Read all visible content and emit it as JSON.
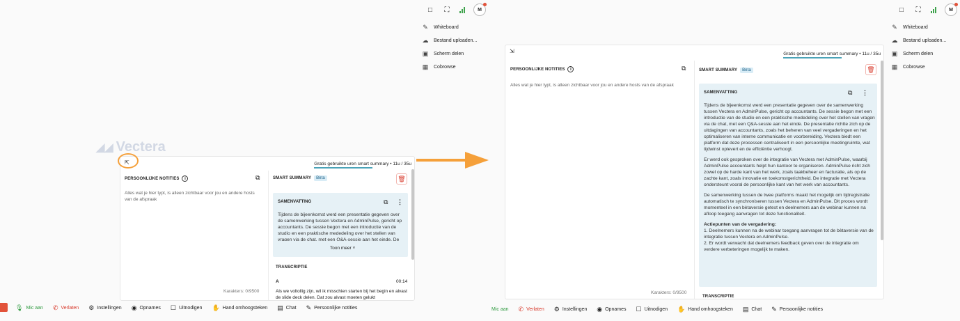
{
  "topbar": {
    "avatar_initial": "M"
  },
  "side_menu": [
    {
      "icon": "pencil-icon",
      "label": "Whiteboard"
    },
    {
      "icon": "cloud-upload-icon",
      "label": "Bestand uploaden..."
    },
    {
      "icon": "screen-share-icon",
      "label": "Scherm delen"
    },
    {
      "icon": "cobrowse-icon",
      "label": "Cobrowse"
    }
  ],
  "logo": {
    "text": "Vectera"
  },
  "panel": {
    "usage_text": "Gratis gebruikte uren smart summary • 11u / 35u",
    "notes_title": "PERSOONLIJKE NOTITIES",
    "notes_placeholder": "Alles wat je hier typt, is alleen zichtbaar voor jou en andere hosts van de afspraak",
    "char_count": "Karakters: 0/9500",
    "summary_title": "SMART SUMMARY",
    "beta_label": "Bèta",
    "samenvatting_title": "SAMENVATTING",
    "show_more": "Toon meer",
    "transcriptie_title": "TRANSCRIPTIE",
    "transcript": {
      "speaker": "A",
      "time": "00:14",
      "text": "Als we voltollig zijn, wil ik misschien starten bij het begin en alvast de slide deck delen. Dat zou alvast moeten gelukt"
    },
    "summary_paragraphs": [
      "Tijdens de bijeenkomst werd een presentatie gegeven over de samenwerking tussen Vectera en AdminPulse, gericht op accountants. De sessie begon met een introductie van de studio en een praktische mededeling over het stellen van vragen via de chat, met een Q&A-sessie aan het einde. De presentatie richtte zich op de uitdagingen van accountants, zoals het beheren van veel vergaderingen en het optimaliseren van interne communicatie en voorbereiding. Vectera biedt een platform dat deze processen centraliseert in een persoonlijke meetingruimte, wat tijdwinst oplevert en de efficiëntie verhoogt.",
      "Er werd ook gesproken over de integratie van Vectera met AdminPulse, waarbij AdminPulse accountants helpt hun kantoor te organiseren. AdminPulse richt zich zowel op de harde kant van het werk, zoals taakbeheer en facturatie, als op de zachte kant, zoals innovatie en toekomstgerichtheid. De integratie met Vectera ondersteunt vooral de persoonlijke kant van het werk van accountants.",
      "De samenwerking tussen de twee platforms maakt het mogelijk om tijdregistratie automatisch te synchroniseren tussen Vectera en AdminPulse. Dit proces wordt momenteel in een bètaversie getest en deelnemers aan de webinar kunnen na afloop toegang aanvragen tot deze functionaliteit."
    ],
    "action_title": "Actiepunten van de vergadering:",
    "action_items": [
      "1. Deelnemers kunnen na de webinar toegang aanvragen tot de bètaversie van de integratie tussen Vectera en AdminPulse.",
      "2. Er wordt verwacht dat deelnemers feedback geven over de integratie om verdere verbeteringen mogelijk te maken."
    ]
  },
  "bottombar": {
    "mic": "Mic aan",
    "leave": "Verlaten",
    "settings": "Instellingen",
    "record": "Opnames",
    "invite": "Uitnodigen",
    "hand": "Hand omhoogsteken",
    "chat": "Chat",
    "notes": "Persoonlijke notities"
  },
  "colors": {
    "accent": "#f5a03a",
    "green": "#2e9a3f",
    "red": "#d8392b",
    "summary_bg": "#e6f1f6"
  }
}
